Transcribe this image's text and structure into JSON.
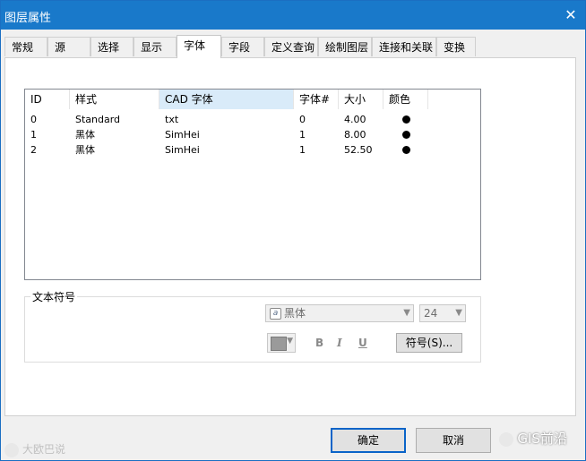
{
  "window": {
    "title": "图层属性",
    "close_glyph": "✕"
  },
  "tabs": [
    {
      "label": "常规"
    },
    {
      "label": "源"
    },
    {
      "label": "选择"
    },
    {
      "label": "显示"
    },
    {
      "label": "字体"
    },
    {
      "label": "字段"
    },
    {
      "label": "定义查询"
    },
    {
      "label": "绘制图层"
    },
    {
      "label": "连接和关联"
    },
    {
      "label": "变换"
    }
  ],
  "active_tab": "字体",
  "list": {
    "columns": [
      "ID",
      "样式",
      "CAD 字体",
      "字体#",
      "大小",
      "颜色"
    ],
    "rows": [
      {
        "id": "0",
        "style": "Standard",
        "cad_font": "txt",
        "font_no": "0",
        "size": "4.00"
      },
      {
        "id": "1",
        "style": "黑体",
        "cad_font": "SimHei",
        "font_no": "1",
        "size": "8.00"
      },
      {
        "id": "2",
        "style": "黑体",
        "cad_font": "SimHei",
        "font_no": "1",
        "size": "52.50"
      }
    ],
    "color_dot": "#000000"
  },
  "text_symbol": {
    "label": "文本符号",
    "font_name": "黑体",
    "font_size": "24",
    "bold": "B",
    "italic": "I",
    "underline": "U",
    "symbol_button": "符号(S)..."
  },
  "buttons": {
    "ok": "确定",
    "cancel": "取消"
  },
  "watermarks": {
    "left": "大欧巴说",
    "right": "GIS前沿"
  }
}
